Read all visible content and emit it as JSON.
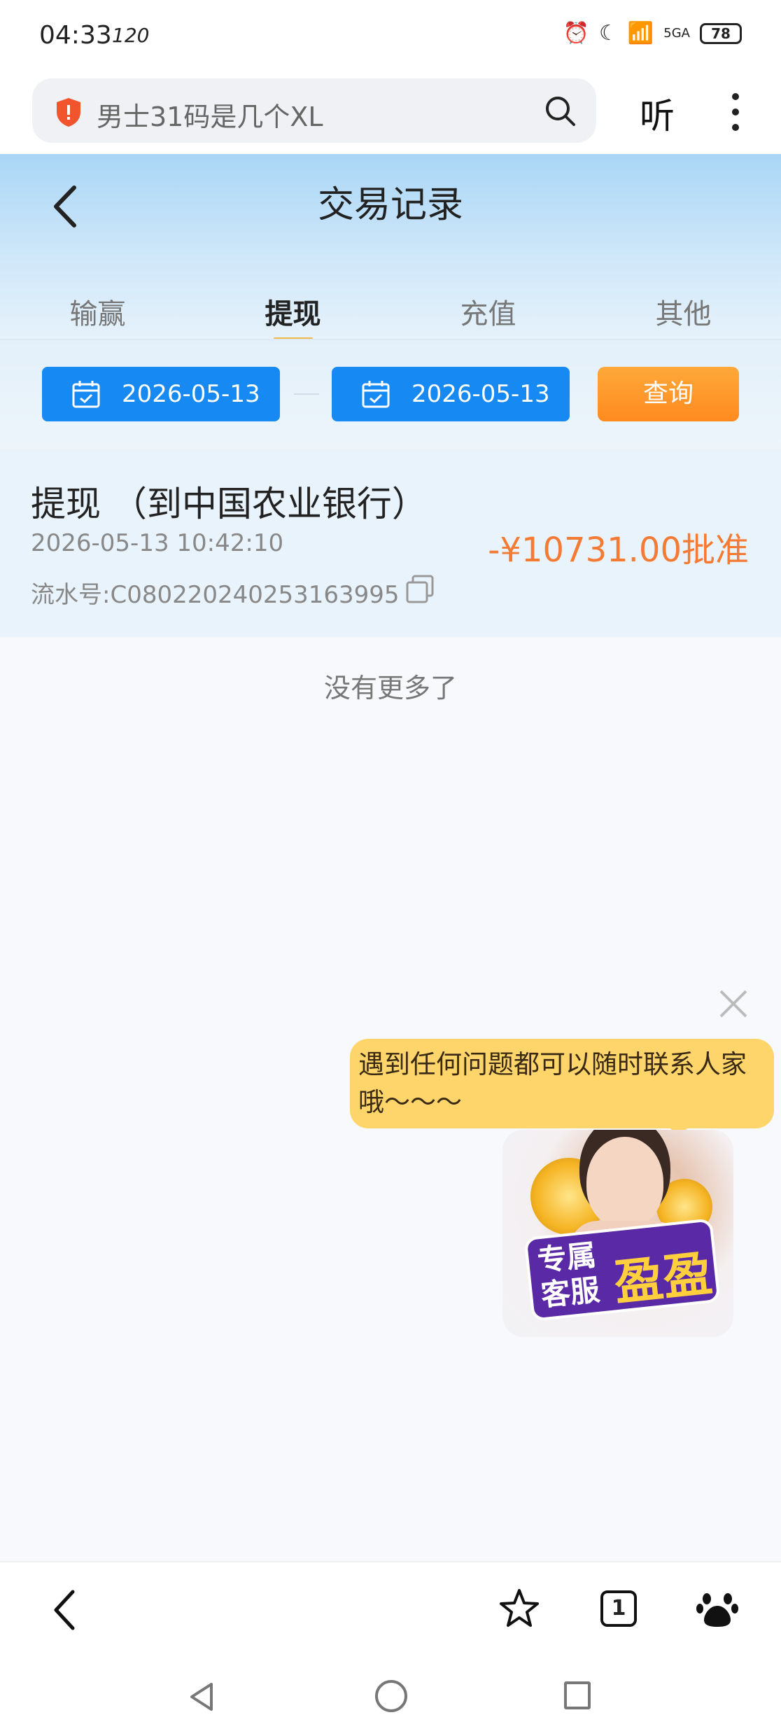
{
  "status_bar": {
    "time": "04:33",
    "refresh_rate": "120",
    "battery": "78",
    "network": "5GA"
  },
  "browser": {
    "search_text": "男士31码是几个XL",
    "listen_label": "听"
  },
  "header": {
    "title": "交易记录"
  },
  "tabs": [
    {
      "label": "输赢",
      "active": false
    },
    {
      "label": "提现",
      "active": true
    },
    {
      "label": "充值",
      "active": false
    },
    {
      "label": "其他",
      "active": false
    }
  ],
  "filter": {
    "start_date": "2026-05-13",
    "end_date": "2026-05-13",
    "query_label": "查询"
  },
  "records": [
    {
      "title": "提现 （到中国农业银行）",
      "time": "2026-05-13 10:42:10",
      "serial": "流水号:C080220240253163995",
      "amount": "-¥10731.00批准"
    }
  ],
  "list_end_text": "没有更多了",
  "service": {
    "bubble_text": "遇到任何问题都可以随时联系人家哦～～～",
    "badge_line1": "专属",
    "badge_line2": "客服",
    "badge_name": "盈盈"
  },
  "bottom_bar": {
    "tab_count": "1"
  },
  "colors": {
    "accent_blue": "#1789f2",
    "query_orange": "#ff8a1f",
    "amount_orange": "#f57a34",
    "bubble_yellow": "#fdd56a"
  }
}
